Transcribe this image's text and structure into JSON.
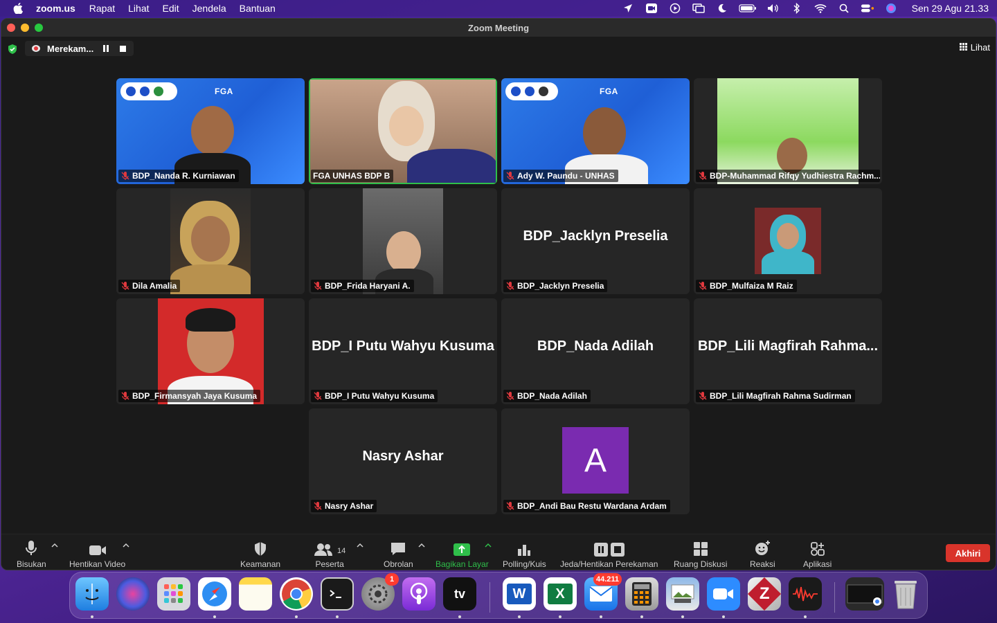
{
  "menubar": {
    "app_name": "zoom.us",
    "menus": [
      "Rapat",
      "Lihat",
      "Edit",
      "Jendela",
      "Bantuan"
    ],
    "clock": "Sen 29 Agu  21.33"
  },
  "window": {
    "title": "Zoom Meeting",
    "recording_label": "Merekam...",
    "view_label": "Lihat"
  },
  "tiles": [
    {
      "name": "BDP_Nanda R. Kurniawan",
      "display": "",
      "muted": true
    },
    {
      "name": "FGA UNHAS BDP B",
      "display": "",
      "muted": false,
      "speaking": true
    },
    {
      "name": "Ady W. Paundu - UNHAS",
      "display": "",
      "muted": true
    },
    {
      "name": "BDP-Muhammad Rifqy Yudhiestra Rachm...",
      "display": "",
      "muted": true
    },
    {
      "name": "Dila Amalia",
      "display": "",
      "muted": true
    },
    {
      "name": "BDP_Frida Haryani A.",
      "display": "",
      "muted": true
    },
    {
      "name": "BDP_Jacklyn Preselia",
      "display": "BDP_Jacklyn Preselia",
      "muted": true
    },
    {
      "name": "BDP_Mulfaiza M Raiz",
      "display": "",
      "muted": true
    },
    {
      "name": "BDP_Firmansyah Jaya Kusuma",
      "display": "",
      "muted": true
    },
    {
      "name": "BDP_I Putu Wahyu Kusuma",
      "display": "BDP_I Putu Wahyu Kusuma",
      "muted": true
    },
    {
      "name": "BDP_Nada Adilah",
      "display": "BDP_Nada Adilah",
      "muted": true
    },
    {
      "name": "BDP_Lili Magfirah Rahma Sudirman",
      "display": "BDP_Lili Magfirah Rahma...",
      "muted": true
    },
    {
      "name": "Nasry Ashar",
      "display": "Nasry Ashar",
      "muted": true
    },
    {
      "name": "BDP_Andi Bau Restu Wardana Ardam",
      "display": "",
      "avatar_letter": "A",
      "muted": true
    }
  ],
  "video_overlay": {
    "fga_text": "FGA"
  },
  "toolbar": {
    "mute": "Bisukan",
    "stop_video": "Hentikan Video",
    "security": "Keamanan",
    "participants": "Peserta",
    "participants_count": "14",
    "chat": "Obrolan",
    "share": "Bagikan Layar",
    "polls": "Polling/Kuis",
    "pause_recording": "Jeda/Hentikan Perekaman",
    "breakout": "Ruang Diskusi",
    "reactions": "Reaksi",
    "apps": "Aplikasi",
    "end": "Akhiri"
  },
  "dock": {
    "settings_badge": "1",
    "mail_badge": "44.211",
    "tv_label": "tv",
    "word_label": "W",
    "excel_label": "X",
    "filezilla_label": "Z"
  },
  "colors": {
    "accent_green": "#2fbf4a",
    "end_red": "#d9342b",
    "muted_red": "#e0393e",
    "avatar_purple": "#7a2bb0"
  }
}
